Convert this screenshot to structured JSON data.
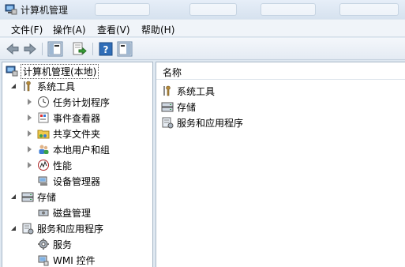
{
  "window": {
    "title": "计算机管理"
  },
  "menu": [
    {
      "label": "文件(F)"
    },
    {
      "label": "操作(A)"
    },
    {
      "label": "查看(V)"
    },
    {
      "label": "帮助(H)"
    }
  ],
  "toolbar": {
    "buttons": [
      "back-icon",
      "forward-icon",
      "show-hide-tree-icon",
      "export-list-icon",
      "help-icon",
      "show-hide-action-pane-icon"
    ]
  },
  "tree": {
    "root": "计算机管理(本地)",
    "system_tools": "系统工具",
    "task_scheduler": "任务计划程序",
    "event_viewer": "事件查看器",
    "shared_folders": "共享文件夹",
    "local_users_groups": "本地用户和组",
    "performance": "性能",
    "device_manager": "设备管理器",
    "storage": "存储",
    "disk_management": "磁盘管理",
    "services_apps": "服务和应用程序",
    "services": "服务",
    "wmi": "WMI 控件"
  },
  "list": {
    "column_name": "名称",
    "items": [
      "系统工具",
      "存储",
      "服务和应用程序"
    ]
  }
}
